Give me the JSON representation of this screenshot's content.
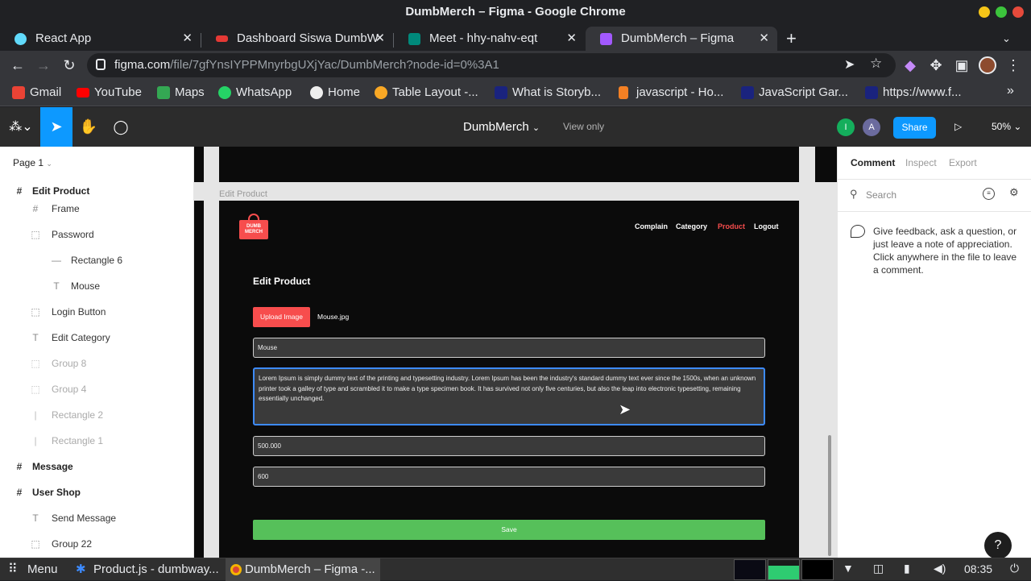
{
  "window": {
    "title": "DumbMerch – Figma - Google Chrome"
  },
  "tabs": [
    {
      "label": "React App",
      "color": "#61dafb"
    },
    {
      "label": "Dashboard Siswa DumbW",
      "color": "#e53935"
    },
    {
      "label": "Meet - hhy-nahv-eqt",
      "color": "#00897b"
    },
    {
      "label": "DumbMerch – Figma",
      "color": "#a259ff"
    }
  ],
  "address": {
    "host": "figma.com",
    "path": "/file/7gfYnsIYPPMnyrbgUXjYac/DumbMerch?node-id=0%3A1"
  },
  "bookmarks": [
    {
      "label": "Gmail",
      "color": "#ea4335"
    },
    {
      "label": "YouTube",
      "color": "#ff0000"
    },
    {
      "label": "Maps",
      "color": "#34a853"
    },
    {
      "label": "WhatsApp",
      "color": "#25d366"
    },
    {
      "label": "Home",
      "color": "#444444"
    },
    {
      "label": "Table Layout -...",
      "color": "#f9a825"
    },
    {
      "label": "What is Storyb...",
      "color": "#1a237e"
    },
    {
      "label": "javascript - Ho...",
      "color": "#f48024"
    },
    {
      "label": "JavaScript Gar...",
      "color": "#1a237e"
    },
    {
      "label": "https://www.f...",
      "color": "#1a237e"
    }
  ],
  "figma": {
    "file_name": "DumbMerch",
    "view_mode": "View only",
    "share_label": "Share",
    "zoom": "50%",
    "avatar_i": "I",
    "avatar_a": "A"
  },
  "left_panel": {
    "page": "Page 1",
    "layers": [
      {
        "label": "Edit Product",
        "icon": "#",
        "style": "bold"
      },
      {
        "label": "Frame",
        "icon": "#",
        "style": "normal"
      },
      {
        "label": "Password",
        "icon": "⬚",
        "style": "normal"
      },
      {
        "label": "Rectangle 6",
        "icon": "—",
        "style": "normal"
      },
      {
        "label": "Mouse",
        "icon": "T",
        "style": "normal"
      },
      {
        "label": "Login Button",
        "icon": "⬚",
        "style": "normal"
      },
      {
        "label": "Edit Category",
        "icon": "T",
        "style": "normal"
      },
      {
        "label": "Group 8",
        "icon": "⬚",
        "style": "dim"
      },
      {
        "label": "Group 4",
        "icon": "⬚",
        "style": "dim"
      },
      {
        "label": "Rectangle 2",
        "icon": "|",
        "style": "dim"
      },
      {
        "label": "Rectangle 1",
        "icon": "|",
        "style": "dim"
      },
      {
        "label": "Message",
        "icon": "#",
        "style": "bold"
      },
      {
        "label": "User Shop",
        "icon": "#",
        "style": "bold"
      },
      {
        "label": "Send Message",
        "icon": "T",
        "style": "normal"
      },
      {
        "label": "Group 22",
        "icon": "⬚",
        "style": "normal"
      }
    ]
  },
  "canvas": {
    "frame_label": "Edit Product",
    "logo_line1": "DUMB",
    "logo_line2": "MERCH",
    "nav": {
      "complain": "Complain",
      "category": "Category",
      "product": "Product",
      "logout": "Logout"
    },
    "heading": "Edit Product",
    "upload_button": "Upload Image",
    "file_name": "Mouse.jpg",
    "name_value": "Mouse",
    "description_value": "Lorem Ipsum is simply dummy text of the printing and typesetting industry. Lorem Ipsum has been the industry's standard dummy text ever since the 1500s, when an unknown printer took a galley of type and scrambled it to make a type specimen book. It has survived not only five centuries, but also the leap into electronic typesetting, remaining essentially unchanged.",
    "price_value": "500.000",
    "stock_value": "600",
    "save_button": "Save"
  },
  "right_panel": {
    "tabs": {
      "comment": "Comment",
      "inspect": "Inspect",
      "export": "Export"
    },
    "search_placeholder": "Search",
    "hint": "Give feedback, ask a question, or just leave a note of appreciation. Click anywhere in the file to leave a comment.",
    "help": "?"
  },
  "taskbar": {
    "menu": "Menu",
    "app1": "Product.js - dumbway...",
    "app2": "DumbMerch – Figma -...",
    "clock": "08:35"
  },
  "colors": {
    "accent_red": "#f74d4d",
    "save_green": "#56c05a",
    "figma_blue": "#0d99ff",
    "focus_blue": "#3d8bff"
  }
}
